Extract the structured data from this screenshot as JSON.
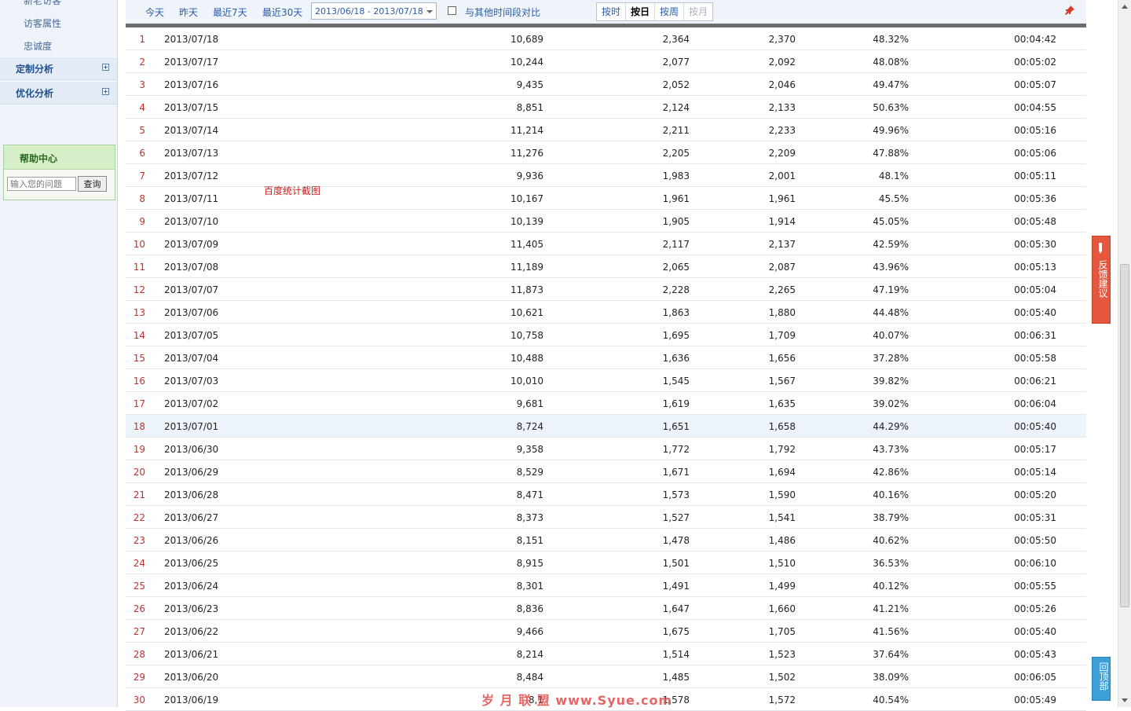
{
  "sidebar": {
    "items": [
      {
        "label": "新老访客"
      },
      {
        "label": "访客属性"
      },
      {
        "label": "忠诚度"
      }
    ],
    "sections": [
      {
        "label": "定制分析"
      },
      {
        "label": "优化分析"
      }
    ],
    "help": {
      "title": "帮助中心",
      "placeholder": "输入您的问题",
      "button": "查询"
    }
  },
  "toolbar": {
    "quick_ranges": [
      "今天",
      "昨天",
      "最近7天",
      "最近30天"
    ],
    "date_range": "2013/06/18 - 2013/07/18",
    "compare_label": "与其他时间段对比",
    "compare_checked": false,
    "granularity": [
      {
        "label": "按时",
        "state": "normal"
      },
      {
        "label": "按日",
        "state": "selected"
      },
      {
        "label": "按周",
        "state": "normal"
      },
      {
        "label": "按月",
        "state": "disabled"
      }
    ]
  },
  "table": {
    "highlighted_row": 18,
    "rows": [
      {
        "idx": "1",
        "date": "2013/07/18",
        "pv": "10,689",
        "uv": "2,364",
        "ip": "2,370",
        "bounce": "48.32%",
        "duration": "00:04:42"
      },
      {
        "idx": "2",
        "date": "2013/07/17",
        "pv": "10,244",
        "uv": "2,077",
        "ip": "2,092",
        "bounce": "48.08%",
        "duration": "00:05:02"
      },
      {
        "idx": "3",
        "date": "2013/07/16",
        "pv": "9,435",
        "uv": "2,052",
        "ip": "2,046",
        "bounce": "49.47%",
        "duration": "00:05:07"
      },
      {
        "idx": "4",
        "date": "2013/07/15",
        "pv": "8,851",
        "uv": "2,124",
        "ip": "2,133",
        "bounce": "50.63%",
        "duration": "00:04:55"
      },
      {
        "idx": "5",
        "date": "2013/07/14",
        "pv": "11,214",
        "uv": "2,211",
        "ip": "2,233",
        "bounce": "49.96%",
        "duration": "00:05:16"
      },
      {
        "idx": "6",
        "date": "2013/07/13",
        "pv": "11,276",
        "uv": "2,205",
        "ip": "2,209",
        "bounce": "47.88%",
        "duration": "00:05:06"
      },
      {
        "idx": "7",
        "date": "2013/07/12",
        "pv": "9,936",
        "uv": "1,983",
        "ip": "2,001",
        "bounce": "48.1%",
        "duration": "00:05:11"
      },
      {
        "idx": "8",
        "date": "2013/07/11",
        "pv": "10,167",
        "uv": "1,961",
        "ip": "1,961",
        "bounce": "45.5%",
        "duration": "00:05:36"
      },
      {
        "idx": "9",
        "date": "2013/07/10",
        "pv": "10,139",
        "uv": "1,905",
        "ip": "1,914",
        "bounce": "45.05%",
        "duration": "00:05:48"
      },
      {
        "idx": "10",
        "date": "2013/07/09",
        "pv": "11,405",
        "uv": "2,117",
        "ip": "2,137",
        "bounce": "42.59%",
        "duration": "00:05:30"
      },
      {
        "idx": "11",
        "date": "2013/07/08",
        "pv": "11,189",
        "uv": "2,065",
        "ip": "2,087",
        "bounce": "43.96%",
        "duration": "00:05:13"
      },
      {
        "idx": "12",
        "date": "2013/07/07",
        "pv": "11,873",
        "uv": "2,228",
        "ip": "2,265",
        "bounce": "47.19%",
        "duration": "00:05:04"
      },
      {
        "idx": "13",
        "date": "2013/07/06",
        "pv": "10,621",
        "uv": "1,863",
        "ip": "1,880",
        "bounce": "44.48%",
        "duration": "00:05:40"
      },
      {
        "idx": "14",
        "date": "2013/07/05",
        "pv": "10,758",
        "uv": "1,695",
        "ip": "1,709",
        "bounce": "40.07%",
        "duration": "00:06:31"
      },
      {
        "idx": "15",
        "date": "2013/07/04",
        "pv": "10,488",
        "uv": "1,636",
        "ip": "1,656",
        "bounce": "37.28%",
        "duration": "00:05:58"
      },
      {
        "idx": "16",
        "date": "2013/07/03",
        "pv": "10,010",
        "uv": "1,545",
        "ip": "1,567",
        "bounce": "39.82%",
        "duration": "00:06:21"
      },
      {
        "idx": "17",
        "date": "2013/07/02",
        "pv": "9,681",
        "uv": "1,619",
        "ip": "1,635",
        "bounce": "39.02%",
        "duration": "00:06:04"
      },
      {
        "idx": "18",
        "date": "2013/07/01",
        "pv": "8,724",
        "uv": "1,651",
        "ip": "1,658",
        "bounce": "44.29%",
        "duration": "00:05:40"
      },
      {
        "idx": "19",
        "date": "2013/06/30",
        "pv": "9,358",
        "uv": "1,772",
        "ip": "1,792",
        "bounce": "43.73%",
        "duration": "00:05:17"
      },
      {
        "idx": "20",
        "date": "2013/06/29",
        "pv": "8,529",
        "uv": "1,671",
        "ip": "1,694",
        "bounce": "42.86%",
        "duration": "00:05:14"
      },
      {
        "idx": "21",
        "date": "2013/06/28",
        "pv": "8,471",
        "uv": "1,573",
        "ip": "1,590",
        "bounce": "40.16%",
        "duration": "00:05:20"
      },
      {
        "idx": "22",
        "date": "2013/06/27",
        "pv": "8,373",
        "uv": "1,527",
        "ip": "1,541",
        "bounce": "38.79%",
        "duration": "00:05:31"
      },
      {
        "idx": "23",
        "date": "2013/06/26",
        "pv": "8,151",
        "uv": "1,478",
        "ip": "1,486",
        "bounce": "40.62%",
        "duration": "00:05:50"
      },
      {
        "idx": "24",
        "date": "2013/06/25",
        "pv": "8,915",
        "uv": "1,501",
        "ip": "1,510",
        "bounce": "36.53%",
        "duration": "00:06:10"
      },
      {
        "idx": "25",
        "date": "2013/06/24",
        "pv": "8,301",
        "uv": "1,491",
        "ip": "1,499",
        "bounce": "40.12%",
        "duration": "00:05:55"
      },
      {
        "idx": "26",
        "date": "2013/06/23",
        "pv": "8,836",
        "uv": "1,647",
        "ip": "1,660",
        "bounce": "41.21%",
        "duration": "00:05:26"
      },
      {
        "idx": "27",
        "date": "2013/06/22",
        "pv": "9,466",
        "uv": "1,675",
        "ip": "1,705",
        "bounce": "41.56%",
        "duration": "00:05:40"
      },
      {
        "idx": "28",
        "date": "2013/06/21",
        "pv": "8,214",
        "uv": "1,514",
        "ip": "1,523",
        "bounce": "37.64%",
        "duration": "00:05:43"
      },
      {
        "idx": "29",
        "date": "2013/06/20",
        "pv": "8,484",
        "uv": "1,485",
        "ip": "1,502",
        "bounce": "38.09%",
        "duration": "00:06:05"
      },
      {
        "idx": "30",
        "date": "2013/06/19",
        "pv": "8,1",
        "uv": "1,578",
        "ip": "1,572",
        "bounce": "40.54%",
        "duration": "00:05:49"
      }
    ]
  },
  "overlay": {
    "caption": "百度统计截图",
    "watermark": "岁 月 联 盟  www.Syue.com"
  },
  "floating": {
    "feedback": "反馈建议",
    "back_to_top": "回顶部"
  },
  "colors": {
    "index_red": "#c0312b",
    "link_blue": "#2a5ca8",
    "help_green": "#2a6a1f",
    "feedback_bg": "#e4573e",
    "top_bg": "#3c9fd8",
    "highlight_row": "#ecf3fb"
  },
  "icons": {
    "pin": "pin-icon",
    "feedback": "pencil-icon",
    "section_expand": "plus-box-icon"
  }
}
